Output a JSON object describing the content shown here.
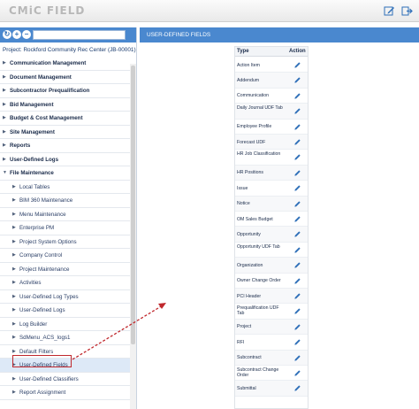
{
  "app": {
    "title": "CMiC FIELD"
  },
  "topbar": {
    "edit_icon": "edit-icon",
    "logout_icon": "logout-icon"
  },
  "left_panel": {
    "toolbar_buttons": [
      {
        "icon": "refresh-icon"
      },
      {
        "icon": "add-icon"
      },
      {
        "icon": "collapse-icon"
      }
    ],
    "search_value": "",
    "project": "Project: Rockford Community Rec Center (JB-00001)",
    "items": [
      {
        "label": "Communication Management",
        "level": 0
      },
      {
        "label": "Document Management",
        "level": 0
      },
      {
        "label": "Subcontractor Prequalification",
        "level": 0
      },
      {
        "label": "Bid Management",
        "level": 0
      },
      {
        "label": "Budget & Cost Management",
        "level": 0
      },
      {
        "label": "Site Management",
        "level": 0
      },
      {
        "label": "Reports",
        "level": 0
      },
      {
        "label": "User-Defined Logs",
        "level": 0
      },
      {
        "label": "File Maintenance",
        "level": 0,
        "expanded": true
      },
      {
        "label": "Local Tables",
        "level": 1
      },
      {
        "label": "BIM 360 Maintenance",
        "level": 1
      },
      {
        "label": "Menu Maintenance",
        "level": 1
      },
      {
        "label": "Enterprise PM",
        "level": 1
      },
      {
        "label": "Project System Options",
        "level": 1
      },
      {
        "label": "Company Control",
        "level": 1
      },
      {
        "label": "Project Maintenance",
        "level": 1
      },
      {
        "label": "Activities",
        "level": 1
      },
      {
        "label": "User-Defined Log Types",
        "level": 1
      },
      {
        "label": "User-Defined Logs",
        "level": 1
      },
      {
        "label": "Log Builder",
        "level": 1
      },
      {
        "label": "SdMenu_ACS_logs1",
        "level": 1
      },
      {
        "label": "Default Filters",
        "level": 1
      },
      {
        "label": "User-Defined Fields",
        "level": 1,
        "selected": true
      },
      {
        "label": "User-Defined Classifiers",
        "level": 1
      },
      {
        "label": "Report Assignment",
        "level": 1
      }
    ]
  },
  "right_panel": {
    "title": "USER-DEFINED FIELDS",
    "columns": {
      "type": "Type",
      "action": "Action"
    },
    "rows": [
      "Action Item",
      "Addendum",
      "Communication",
      "Daily Journal UDF Tab",
      "Employee Profile",
      "Forecast UDF",
      "HR Job Classification",
      "HR Positions",
      "Issue",
      "Notice",
      "OM Sales Budget",
      "Opportunity",
      "Opportunity UDF Tab",
      "Organization",
      "Owner Change Order",
      "PCI Header",
      "Prequalification UDF Tab",
      "Project",
      "RFI",
      "Subcontract",
      "Subcontract Change Order",
      "Submittal"
    ]
  },
  "colors": {
    "accent": "#4a88cf",
    "annotation": "#c0282d",
    "edit_icon": "#2e6fb8"
  }
}
